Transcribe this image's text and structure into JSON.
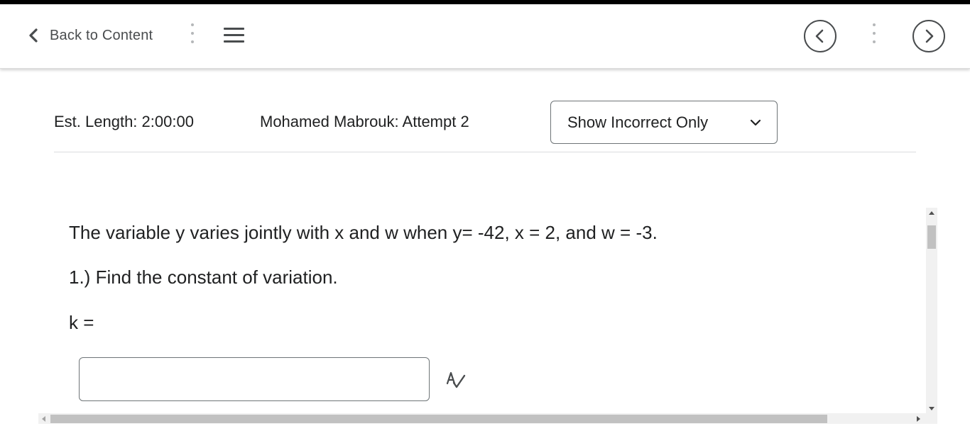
{
  "nav": {
    "back_label": "Back to Content",
    "icons": [
      "chevron-left-icon",
      "more-vertical-icon",
      "menu-icon",
      "previous-icon",
      "next-icon"
    ]
  },
  "quiz_info": {
    "est_length": "Est. Length: 2:00:00",
    "attempt": "Mohamed Mabrouk: Attempt 2",
    "filter": {
      "selected": "Show Incorrect Only"
    }
  },
  "question": {
    "text": "The variable y varies jointly with x and w when y= -42, x = 2, and w = -3.",
    "part": "1.) Find the constant of variation.",
    "answer_label": "k =",
    "answer_value": ""
  },
  "colors": {
    "top_strip": "#000000",
    "text": "#202122",
    "icon": "#494c4e",
    "border": "#6e7477"
  }
}
